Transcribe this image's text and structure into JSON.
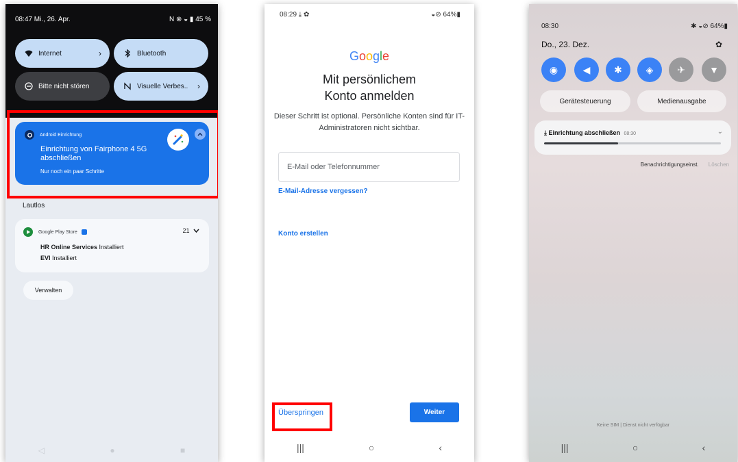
{
  "phone1": {
    "status": {
      "time_date": "08:47 Mi., 26. Apr.",
      "icons": "N  ⊗  ◒  ▮ 45 %"
    },
    "tiles": [
      {
        "label": "Internet",
        "icon": "wifi-icon",
        "chevron": "›"
      },
      {
        "label": "Bluetooth",
        "icon": "bluetooth-icon",
        "chevron": ""
      },
      {
        "label": "Bitte nicht stören",
        "icon": "do-not-disturb-icon",
        "chevron": ""
      },
      {
        "label": "Visuelle Verbes..",
        "icon": "nfc-icon",
        "chevron": "›"
      }
    ],
    "setup_notification": {
      "app": "Android Einrichtung",
      "title": "Einrichtung von Fairphone 4 5G abschließen",
      "subtitle": "Nur noch ein paar Schritte"
    },
    "section_label": "Lautlos",
    "play_card": {
      "app": "Google Play Store",
      "count": "21",
      "lines": [
        {
          "bold": "HR Online Services",
          "rest": " Installiert"
        },
        {
          "bold": "EVI",
          "rest": " Installiert"
        }
      ]
    },
    "manage_label": "Verwalten",
    "nav": {
      "back": "◁",
      "home": "●",
      "recent": "■"
    }
  },
  "phone2": {
    "status": {
      "left": "08:29 ⤓ ✿",
      "right": "◒⊘ 64%▮"
    },
    "logo": "Google",
    "heading": "Mit persönlichem Konto anmelden",
    "description": "Dieser Schritt ist optional. Persönliche Konten sind für IT-Administratoren nicht sichtbar.",
    "email_placeholder": "E-Mail oder Telefonnummer",
    "forgot_link": "E-Mail-Adresse vergessen?",
    "create_link": "Konto erstellen",
    "skip_label": "Überspringen",
    "next_label": "Weiter",
    "nav": {
      "recent": "|||",
      "home": "○",
      "back": "‹"
    }
  },
  "phone3": {
    "status": {
      "time": "08:30",
      "icons": "✱ ◒⊘ 64%▮"
    },
    "date": "Do., 23. Dez.",
    "toggles": [
      {
        "icon": "wifi-icon",
        "glyph": "◉",
        "on": true
      },
      {
        "icon": "sound-icon",
        "glyph": "◀",
        "on": true
      },
      {
        "icon": "bluetooth-icon",
        "glyph": "✱",
        "on": true
      },
      {
        "icon": "auto-rotate-icon",
        "glyph": "◈",
        "on": true
      },
      {
        "icon": "airplane-icon",
        "glyph": "✈",
        "on": false
      },
      {
        "icon": "flashlight-icon",
        "glyph": "▼",
        "on": false
      }
    ],
    "pill_device": "Gerätesteuerung",
    "pill_media": "Medienausgabe",
    "notification": {
      "title": "Einrichtung abschließen",
      "time": "08:30",
      "progress": 0.42
    },
    "action_settings": "Benachrichtigungseinst.",
    "action_clear": "Löschen",
    "no_sim": "Keine SIM | Dienst nicht verfügbar",
    "nav": {
      "recent": "|||",
      "home": "○",
      "back": "‹"
    }
  },
  "colors": {
    "accent_blue": "#1a73e8",
    "highlight_red": "#ff0000",
    "samsung_blue": "#3b82f6"
  }
}
